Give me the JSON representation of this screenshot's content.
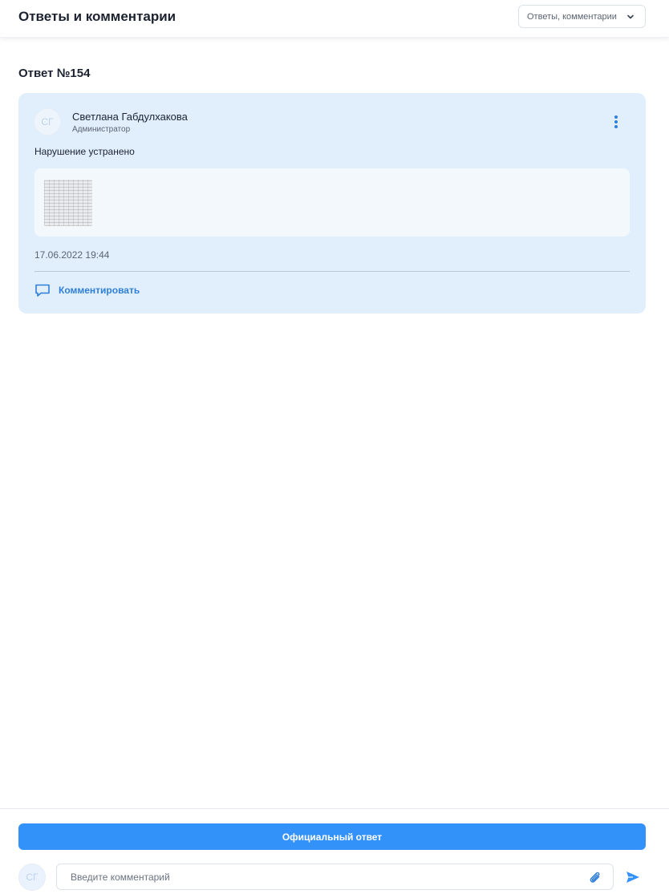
{
  "header": {
    "title": "Ответы и комментарии",
    "filter": {
      "selected": "Ответы, комментарии"
    }
  },
  "answer": {
    "heading": "Ответ №154",
    "author": {
      "initials": "СГ",
      "name": "Светлана Габдулхакова",
      "role": "Администратор"
    },
    "text": "Нарушение устранено",
    "attachments": [
      {
        "type": "image",
        "icon": "document-thumbnail"
      }
    ],
    "timestamp": "17.06.2022 19:44",
    "comment_label": "Комментировать"
  },
  "footer": {
    "official_label": "Официальный ответ",
    "user_initials": "СГ",
    "comment_placeholder": "Введите комментарий"
  },
  "colors": {
    "accent": "#3391fa",
    "link": "#2f7fd6",
    "card_bg": "#e1effd"
  },
  "icons": {
    "filter_chevron": "chevron-down-icon",
    "more": "more-vertical-icon",
    "comment": "comment-bubble-icon",
    "attach": "paperclip-icon",
    "send": "send-icon"
  }
}
